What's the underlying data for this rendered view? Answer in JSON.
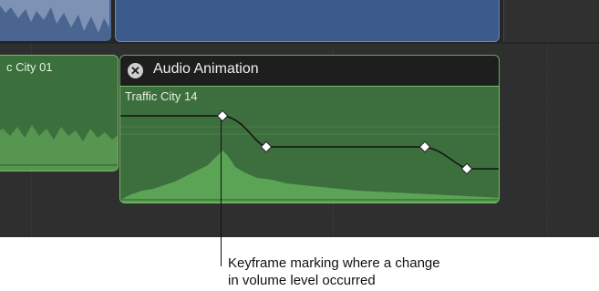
{
  "left_clip": {
    "label": "c City 01"
  },
  "audio_animation": {
    "title": "Audio Animation",
    "close_icon": "close-icon"
  },
  "main_clip": {
    "label": "Traffic City 14"
  },
  "keyframes": [
    {
      "name": "keyframe-peak",
      "level": 0.0
    },
    {
      "name": "keyframe-drop",
      "level": -1.0
    },
    {
      "name": "keyframe-hold",
      "level": -1.0
    },
    {
      "name": "keyframe-end",
      "level": -1.7
    }
  ],
  "callout": {
    "line1": "Keyframe marking where a change",
    "line2": "in volume level occurred"
  },
  "colors": {
    "timeline_bg": "#2f2f2f",
    "video_clip": "#3c5a8c",
    "audio_clip": "#3d6e3e",
    "audio_border": "#7bbb6c"
  }
}
